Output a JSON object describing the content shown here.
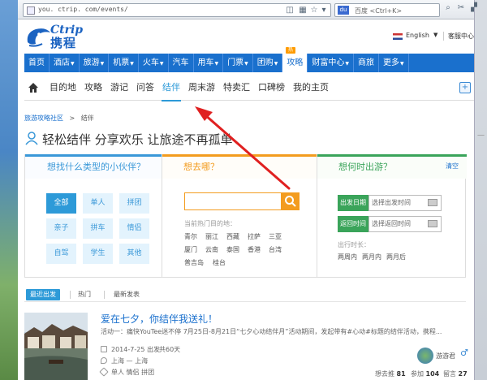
{
  "browser": {
    "address": "you. ctrip. com/events/",
    "search_placeholder": "百度 <Ctrl+K>",
    "search_engine_label": "du"
  },
  "header": {
    "logo_en": "Ctrip",
    "logo_cn": "携程",
    "language": "English",
    "service": "客服中心"
  },
  "main_nav": {
    "items": [
      {
        "label": "首页",
        "arrow": false
      },
      {
        "label": "酒店",
        "arrow": true
      },
      {
        "label": "旅游",
        "arrow": true
      },
      {
        "label": "机票",
        "arrow": true
      },
      {
        "label": "火车",
        "arrow": true
      },
      {
        "label": "汽车",
        "arrow": false
      },
      {
        "label": "用车",
        "arrow": true
      },
      {
        "label": "门票",
        "arrow": true
      },
      {
        "label": "团购",
        "arrow": true
      },
      {
        "label": "攻略",
        "arrow": false
      },
      {
        "label": "财富中心",
        "arrow": true
      },
      {
        "label": "商旅",
        "arrow": false
      },
      {
        "label": "更多",
        "arrow": true
      }
    ],
    "active_index": 9,
    "hot_badge": "热"
  },
  "sub_nav": {
    "items": [
      "目的地",
      "攻略",
      "游记",
      "问答",
      "结伴",
      "周末游",
      "特卖汇",
      "口碑榜",
      "我的主页"
    ],
    "active_index": 4
  },
  "breadcrumb": {
    "root": "旅游攻略社区",
    "sep": ">",
    "current": "结伴"
  },
  "page_title": "轻松结伴 分享欢乐 让旅途不再孤单",
  "side_mark": "一",
  "filter": {
    "col1_title": "想找什么类型的小伙伴？",
    "col2_title": "想去哪？",
    "col3_title": "想何时出游？",
    "clear": "清空",
    "types": [
      "全部",
      "单人",
      "拼团",
      "亲子",
      "拼车",
      "情侣",
      "自驾",
      "学生",
      "其他"
    ],
    "active_type": 0,
    "dest_placeholder": "",
    "hot_label": "当前热门目的地：",
    "cities": [
      [
        "青尔",
        "丽江",
        "西藏",
        "拉萨",
        "三亚"
      ],
      [
        "厦门",
        "云南",
        "泰国",
        "香港",
        "台湾"
      ],
      [
        "普吉岛",
        "桂台"
      ]
    ],
    "depart_btn": "出发日期",
    "depart_field": "选择出发时间",
    "return_btn": "返回时间",
    "return_field": "选择返回时间",
    "period_label": "出行时长：",
    "periods": [
      "两周内",
      "两月内",
      "两月后"
    ]
  },
  "list_tabs": {
    "items": [
      "最近出发",
      "热门",
      "最新发表"
    ],
    "active_index": 0
  },
  "post": {
    "title": "爱在七夕，你结伴我送礼！",
    "desc": "活动一：痛快YouTee迷不停 7月25日-8月21日“七夕心动结伴月”活动期间，发起带有#心动#标题的结伴活动，携程...",
    "date": "2014-7-25 出发",
    "days": "共60天",
    "route": "上海 — 上海",
    "tags": "单人  情侣  拼团",
    "author": "游游君",
    "gender": "♂",
    "stats": [
      {
        "label": "想去推",
        "value": "81"
      },
      {
        "label": "参加",
        "value": "104"
      },
      {
        "label": "留言",
        "value": "27"
      }
    ]
  },
  "colors": {
    "brand_blue": "#1a70cd",
    "tab_blue": "#2d9ad8",
    "orange": "#f39c1f",
    "green": "#3aa45a",
    "annotation_red": "#e02020"
  }
}
